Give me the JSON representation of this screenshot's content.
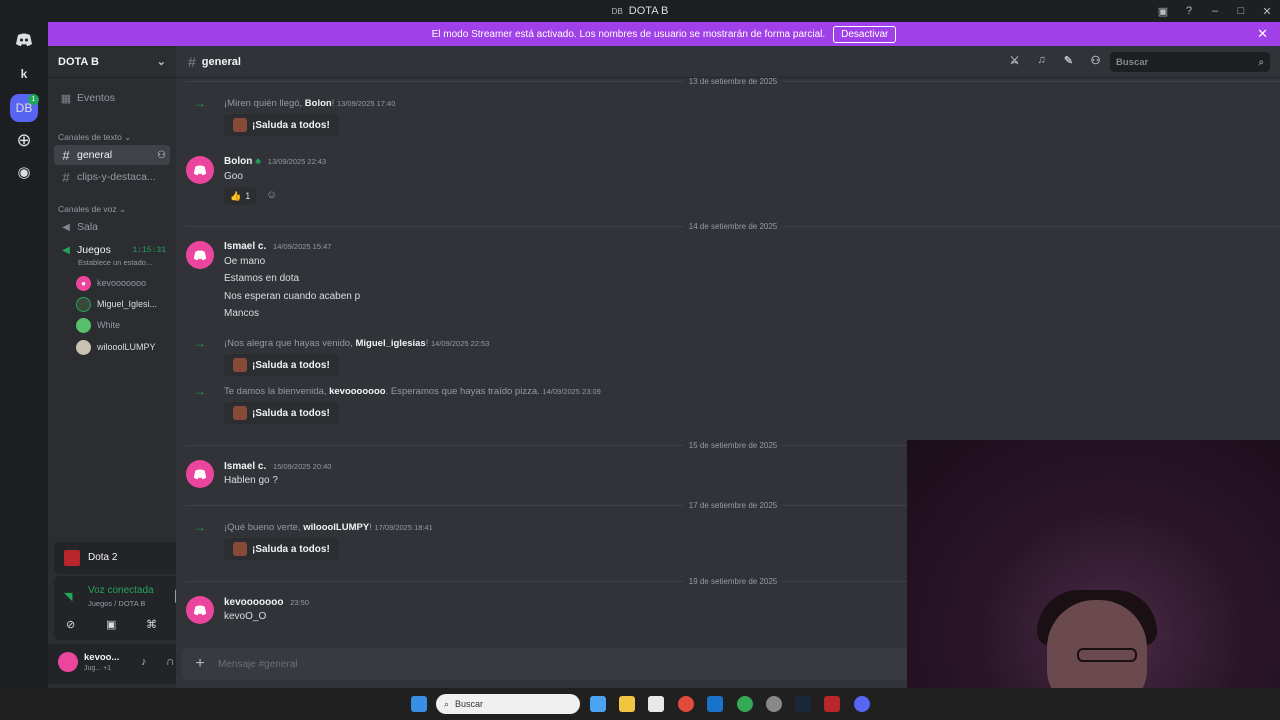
{
  "window": {
    "title": "DOTA B",
    "badge": "DB"
  },
  "streamer_banner": {
    "text": "El modo Streamer está activado. Los nombres de usuario se mostrarán de forma parcial.",
    "button": "Desactivar",
    "color": "#a040e8"
  },
  "guilds": {
    "user_initial": "k",
    "server_initials": "DB",
    "notification_count": "1"
  },
  "server": {
    "name": "DOTA B",
    "events_label": "Eventos",
    "text_category": "Canales de texto",
    "text_channels": [
      "general",
      "clips-y-destaca..."
    ],
    "voice_category": "Canales de voz",
    "voice_channels": [
      "Sala",
      "Juegos"
    ],
    "voice_timer": "1:15:31",
    "voice_status": "Establece un estado...",
    "voice_users": [
      "kevooooooo",
      "Miguel_Iglesi...",
      "White",
      "wilooolLUMPY"
    ]
  },
  "activity_panel": {
    "game": "Dota 2"
  },
  "voice_panel": {
    "status": "Voz conectada",
    "location": "Juegos / DOTA B"
  },
  "user_panel": {
    "name": "kevoo...",
    "status": "Jug... +1"
  },
  "channel": {
    "name": "general",
    "search_placeholder": "Buscar",
    "composer_placeholder": "Mensaje #general"
  },
  "dates": {
    "d13": "13 de setiembre de 2025",
    "d14": "14 de setiembre de 2025",
    "d15": "15 de setiembre de 2025",
    "d17": "17 de setiembre de 2025",
    "d19": "19 de setiembre de 2025"
  },
  "wave_label": "¡Saluda a todos!",
  "messages": {
    "join1": {
      "pre": "¡Miren quién llegó, ",
      "name": "Bolon",
      "post": "!",
      "ts": "13/09/2025 17:40"
    },
    "bolon": {
      "author": "Bolon",
      "ts": "13/09/2025 22:43",
      "text": "Goo",
      "reaction_count": "1"
    },
    "ismael1": {
      "author": "Ismael c.",
      "ts": "14/09/2025 15:47",
      "lines": [
        "Oe mano",
        "Estamos en dota",
        "Nos esperan cuando acaben p",
        "Mancos"
      ]
    },
    "join2": {
      "pre": "¡Nos alegra que hayas venido, ",
      "name": "Miguel_iglesias",
      "post": "!",
      "ts": "14/09/2025 22:53"
    },
    "join3": {
      "pre": "Te damos la bienvenida, ",
      "name": "kevooooooo",
      "post": ". Esperamos que hayas traído pizza.",
      "ts": "14/09/2025 23:09"
    },
    "ismael2": {
      "author": "Ismael c.",
      "ts": "15/09/2025 20:40",
      "text": "Hablen go ?"
    },
    "join4": {
      "pre": "¡Qué bueno verte, ",
      "name": "wilooolLUMPY",
      "post": "!",
      "ts": "17/09/2025 18:41"
    },
    "kevo": {
      "author": "kevooooooo",
      "ts": "23:50",
      "text": "kevoO_O"
    }
  },
  "taskbar": {
    "search": "Buscar"
  }
}
